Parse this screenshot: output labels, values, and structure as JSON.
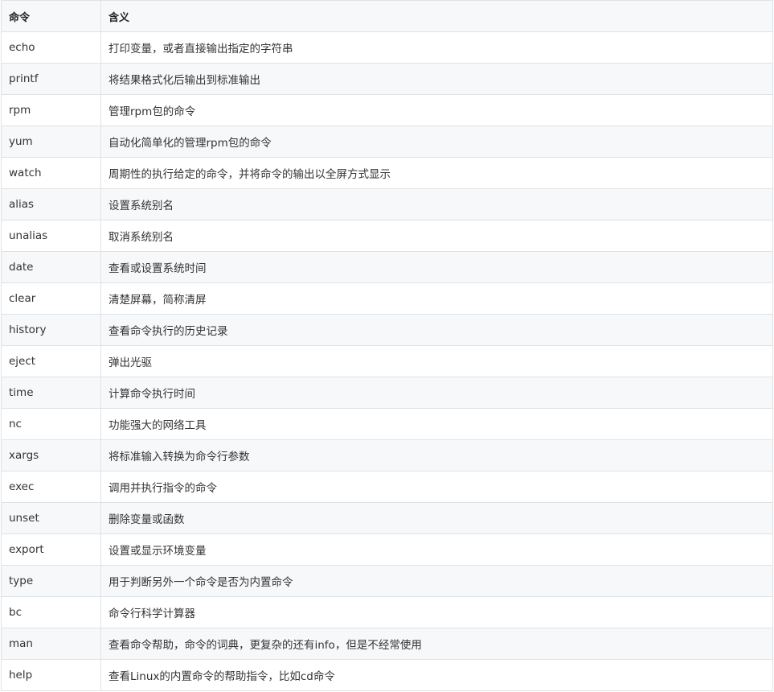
{
  "table": {
    "headers": {
      "command": "命令",
      "meaning": "含义"
    },
    "rows": [
      {
        "command": "echo",
        "meaning": "打印变量，或者直接输出指定的字符串"
      },
      {
        "command": "printf",
        "meaning": "将结果格式化后输出到标准输出"
      },
      {
        "command": "rpm",
        "meaning": "管理rpm包的命令"
      },
      {
        "command": "yum",
        "meaning": "自动化简单化的管理rpm包的命令"
      },
      {
        "command": "watch",
        "meaning": "周期性的执行给定的命令，并将命令的输出以全屏方式显示"
      },
      {
        "command": "alias",
        "meaning": "设置系统别名"
      },
      {
        "command": "unalias",
        "meaning": "取消系统别名"
      },
      {
        "command": "date",
        "meaning": "查看或设置系统时间"
      },
      {
        "command": "clear",
        "meaning": "清楚屏幕，简称清屏"
      },
      {
        "command": "history",
        "meaning": "查看命令执行的历史记录"
      },
      {
        "command": "eject",
        "meaning": "弹出光驱"
      },
      {
        "command": "time",
        "meaning": "计算命令执行时间"
      },
      {
        "command": "nc",
        "meaning": "功能强大的网络工具"
      },
      {
        "command": "xargs",
        "meaning": "将标准输入转换为命令行参数"
      },
      {
        "command": "exec",
        "meaning": "调用并执行指令的命令"
      },
      {
        "command": "unset",
        "meaning": "删除变量或函数"
      },
      {
        "command": "export",
        "meaning": "设置或显示环境变量"
      },
      {
        "command": "type",
        "meaning": "用于判断另外一个命令是否为内置命令"
      },
      {
        "command": "bc",
        "meaning": "命令行科学计算器"
      },
      {
        "command": "man",
        "meaning": "查看命令帮助，命令的词典，更复杂的还有info，但是不经常使用"
      },
      {
        "command": "help",
        "meaning": "查看Linux的内置命令的帮助指令，比如cd命令"
      }
    ]
  }
}
